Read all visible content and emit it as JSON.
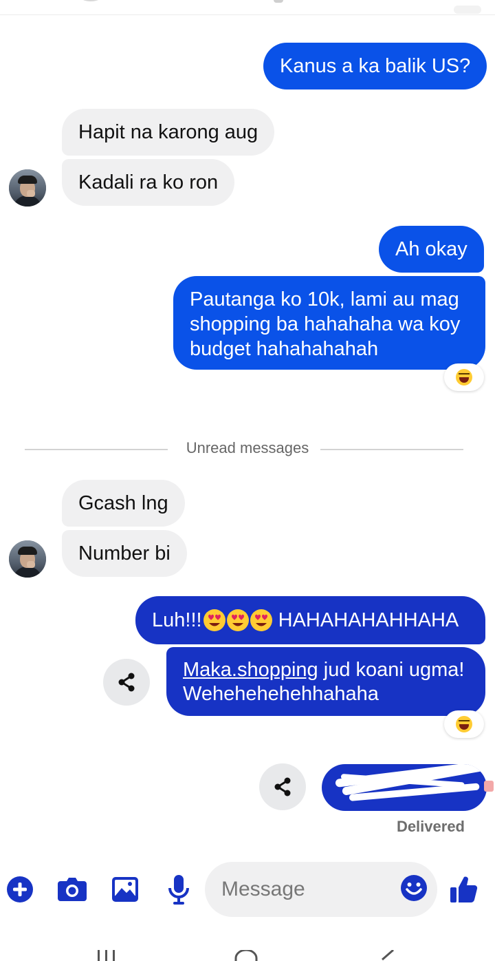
{
  "colors": {
    "outgoing_bubble": "#0a52e8",
    "outgoing_bubble_dark": "#1733c4",
    "incoming_bubble": "#f0f0f1",
    "composer_icon": "#1733c4"
  },
  "messages": [
    {
      "direction": "out",
      "text": "Kanus a ka balik US?"
    },
    {
      "direction": "in",
      "text": "Hapit na karong aug"
    },
    {
      "direction": "in",
      "text": "Kadali ra ko ron"
    },
    {
      "direction": "out",
      "text": "Ah okay"
    },
    {
      "direction": "out",
      "text": "Pautanga ko 10k, lami au mag shopping ba hahahaha wa koy budget hahahahahah",
      "reaction": "laughing-emoji"
    },
    {
      "direction": "in",
      "text": "Gcash lng"
    },
    {
      "direction": "in",
      "text": "Number bi"
    },
    {
      "direction": "out",
      "text_before": "Luh!!!",
      "emojis": [
        "heart-eyes-emoji",
        "heart-eyes-emoji",
        "heart-eyes-emoji"
      ],
      "text_after": " HAHAHAHAHHAHA"
    },
    {
      "direction": "out",
      "link_text": "Maka.shopping",
      "text": " jud koani ugma! Wehehehehehhahaha",
      "reaction": "laughing-emoji"
    },
    {
      "direction": "out",
      "redacted": true
    }
  ],
  "divider": {
    "label": "Unread messages"
  },
  "status": {
    "delivered": "Delivered"
  },
  "composer": {
    "placeholder": "Message",
    "icons": [
      "plus-circle-icon",
      "camera-icon",
      "image-icon",
      "microphone-icon",
      "smile-icon",
      "thumbs-up-icon"
    ]
  },
  "navbar": {
    "icons": [
      "recent-apps-icon",
      "home-icon",
      "back-icon"
    ]
  }
}
